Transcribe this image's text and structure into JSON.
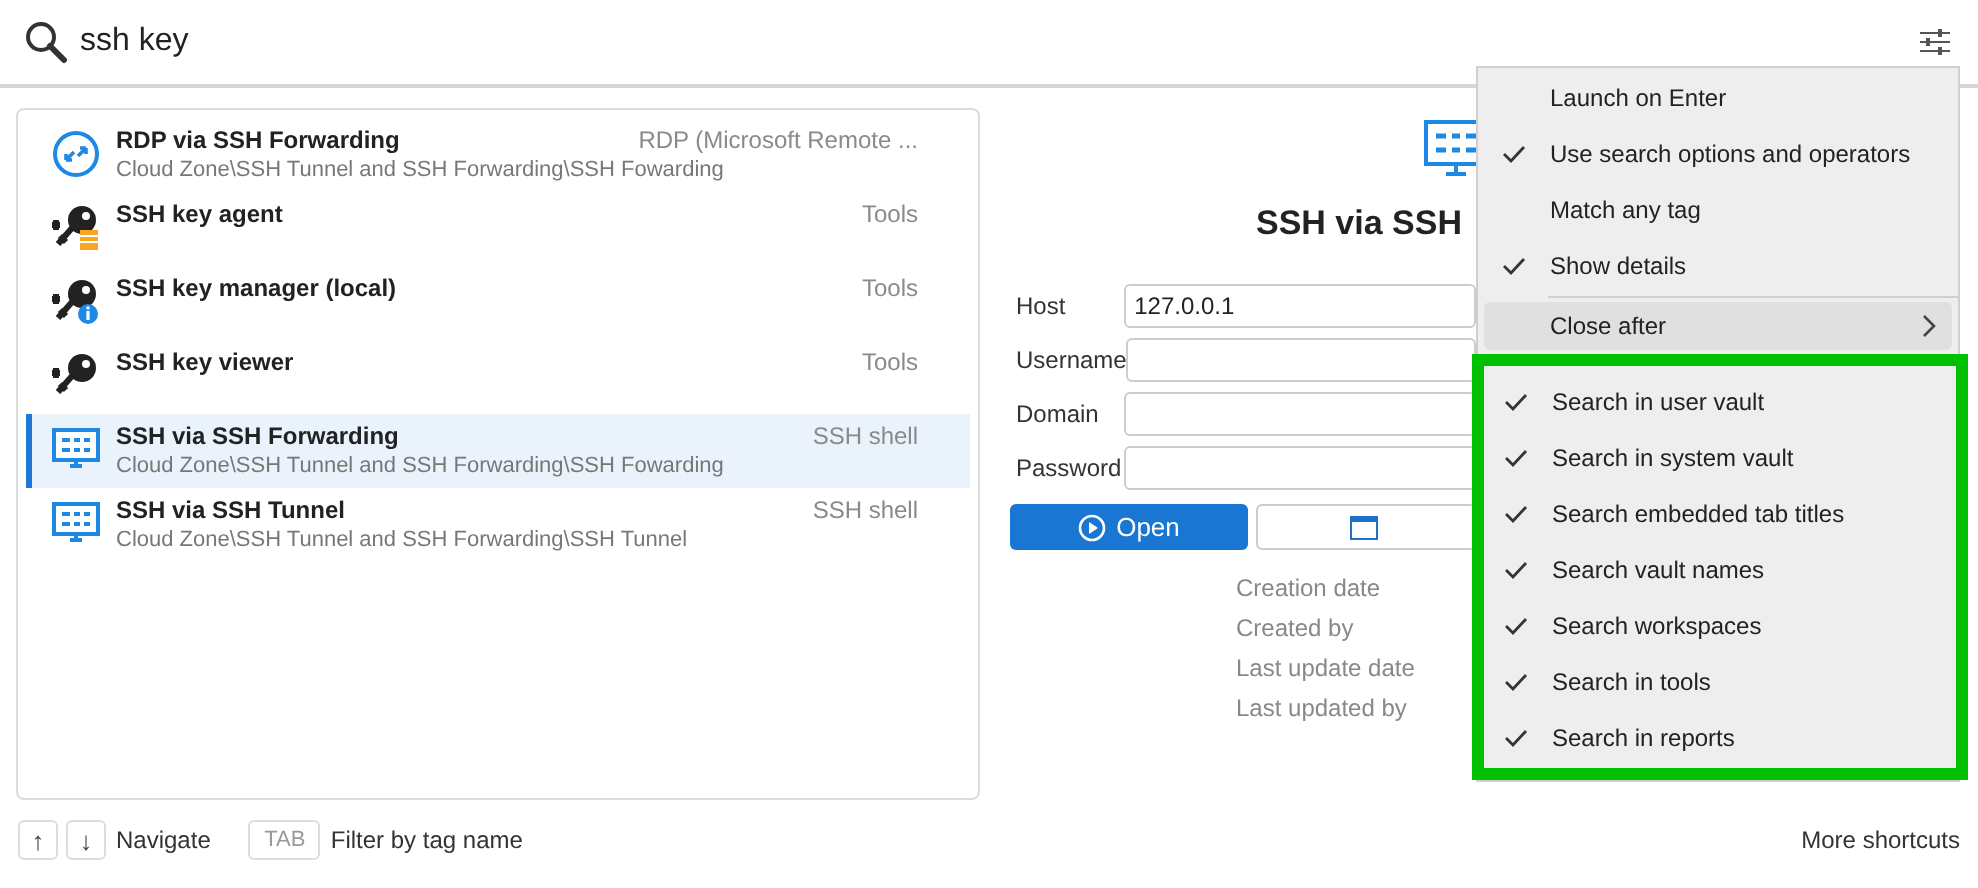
{
  "search": {
    "value": "ssh key"
  },
  "results": [
    {
      "kind": "rdp",
      "title": "RDP via SSH Forwarding",
      "type": "RDP (Microsoft Remote ...",
      "path": "Cloud Zone\\SSH Tunnel and SSH Forwarding\\SSH Fowarding",
      "selected": false
    },
    {
      "kind": "key-agent",
      "title": "SSH key agent",
      "type": "Tools",
      "selected": false
    },
    {
      "kind": "key-manager",
      "title": "SSH key manager (local)",
      "type": "Tools",
      "selected": false
    },
    {
      "kind": "key-viewer",
      "title": "SSH key viewer",
      "type": "Tools",
      "selected": false
    },
    {
      "kind": "ssh",
      "title": "SSH via SSH Forwarding",
      "type": "SSH shell",
      "path": "Cloud Zone\\SSH Tunnel and SSH Forwarding\\SSH Fowarding",
      "selected": true
    },
    {
      "kind": "ssh",
      "title": "SSH via SSH Tunnel",
      "type": "SSH shell",
      "path": "Cloud Zone\\SSH Tunnel and SSH Forwarding\\SSH Tunnel",
      "selected": false
    }
  ],
  "details": {
    "title": "SSH via SSH",
    "fields": [
      {
        "label": "Host",
        "value": "127.0.0.1"
      },
      {
        "label": "Username"
      },
      {
        "label": "Domain"
      },
      {
        "label": "Password"
      }
    ],
    "open_button": "Open",
    "meta_labels": [
      "Creation date",
      "Created by",
      "Last update date",
      "Last updated by"
    ]
  },
  "menu": {
    "options": [
      {
        "label": "Launch on Enter",
        "checked": false
      },
      {
        "label": "Use search options and operators",
        "checked": true
      },
      {
        "label": "Match any tag",
        "checked": false
      },
      {
        "label": "Show details",
        "checked": true
      }
    ],
    "submenu": {
      "label": "Close after",
      "hovered": true
    },
    "search_scopes": [
      {
        "label": "Search in user vault",
        "checked": true
      },
      {
        "label": "Search in system vault",
        "checked": true
      },
      {
        "label": "Search embedded tab titles",
        "checked": true
      },
      {
        "label": "Search vault names",
        "checked": true
      },
      {
        "label": "Search workspaces",
        "checked": true
      },
      {
        "label": "Search in tools",
        "checked": true
      },
      {
        "label": "Search in reports",
        "checked": true
      }
    ]
  },
  "footer": {
    "up_key": "↑",
    "down_key": "↓",
    "navigate": "Navigate",
    "tab_key": "TAB",
    "filter": "Filter by tag name",
    "more": "More shortcuts"
  }
}
